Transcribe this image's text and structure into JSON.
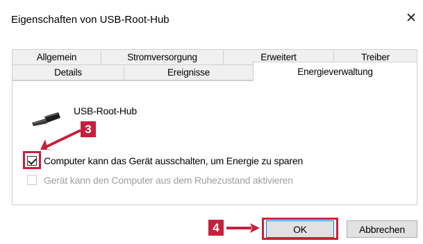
{
  "window": {
    "title": "Eigenschaften von USB-Root-Hub"
  },
  "tabs": {
    "row1": [
      "Allgemein",
      "Stromversorgung",
      "Erweitert",
      "Treiber"
    ],
    "row2": [
      "Details",
      "Ereignisse",
      "Energieverwaltung"
    ]
  },
  "device": {
    "name": "USB-Root-Hub"
  },
  "options": {
    "allow_off": "Computer kann das Gerät ausschalten, um Energie zu sparen",
    "allow_wake": "Gerät kann den Computer aus dem Ruhezustand aktivieren"
  },
  "state": {
    "allow_off_checked": true,
    "allow_wake_checked": false,
    "allow_wake_enabled": false
  },
  "annotations": {
    "step3": "3",
    "step4": "4",
    "color": "#c4213d"
  },
  "buttons": {
    "ok": "OK",
    "cancel": "Abbrechen"
  },
  "icons": {
    "close": "close-icon",
    "device": "usb-plug-icon"
  }
}
